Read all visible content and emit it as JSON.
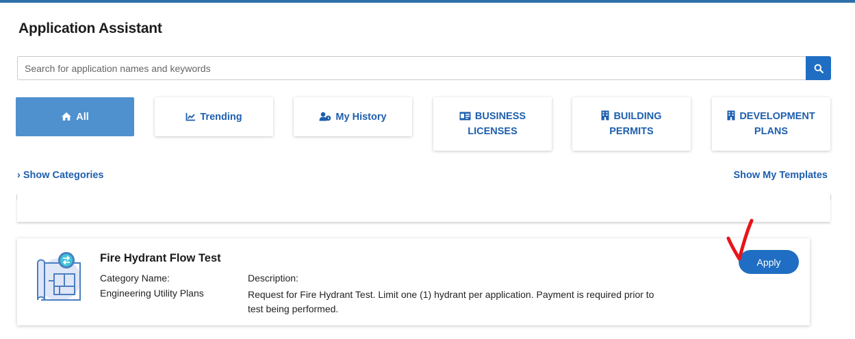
{
  "page": {
    "title": "Application Assistant"
  },
  "search": {
    "placeholder": "Search for application names and keywords",
    "icon": "search-icon"
  },
  "tabs": [
    {
      "label": "All",
      "icon": "home-icon",
      "active": true
    },
    {
      "label": "Trending",
      "icon": "trending-chart-icon",
      "active": false
    },
    {
      "label": "My History",
      "icon": "user-history-icon",
      "active": false
    },
    {
      "label_line1": "BUSINESS",
      "label_line2": "LICENSES",
      "icon": "id-card-icon",
      "active": false
    },
    {
      "label_line1": "BUILDING",
      "label_line2": "PERMITS",
      "icon": "building-icon",
      "active": false
    },
    {
      "label_line1": "DEVELOPMENT",
      "label_line2": "PLANS",
      "icon": "building-icon",
      "active": false
    }
  ],
  "links": {
    "show_categories": "› Show Categories",
    "show_templates": "Show My Templates"
  },
  "result": {
    "title": "Fire Hydrant Flow Test",
    "category_label": "Category Name:",
    "category_value": "Engineering Utility Plans",
    "description_label": "Description:",
    "description_value": "Request for Fire Hydrant Test. Limit one (1) hydrant per application. Payment is required prior to test being performed.",
    "apply_label": "Apply"
  },
  "colors": {
    "accent": "#1f6ec3",
    "active_tile": "#4f90cf",
    "link": "#1e5fae",
    "annotation": "#e8141b"
  }
}
